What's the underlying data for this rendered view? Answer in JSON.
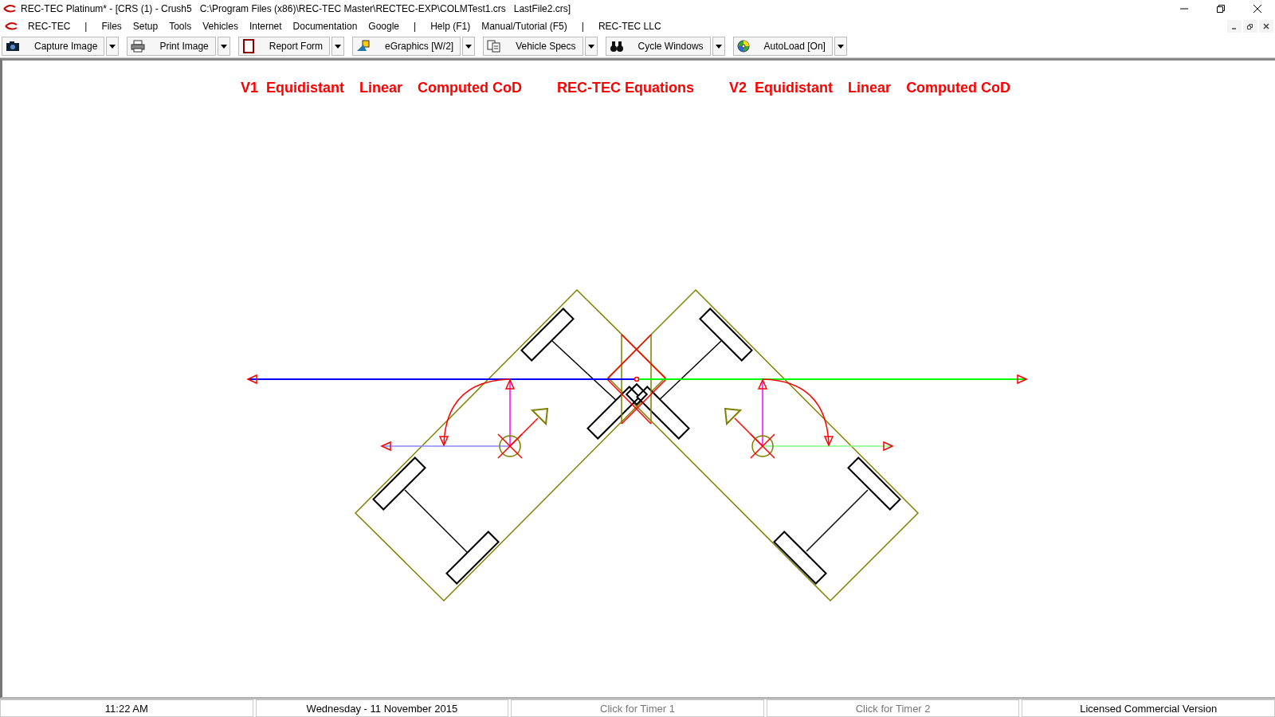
{
  "window": {
    "title": "REC-TEC Platinum* - [CRS (1) - Crush5   C:\\Program Files (x86)\\REC-TEC Master\\RECTEC-EXP\\COLMTest1.crs   LastFile2.crs]"
  },
  "menu": [
    {
      "label": "REC-TEC",
      "kind": "item"
    },
    {
      "label": "|",
      "kind": "separator"
    },
    {
      "label": "Files",
      "kind": "item"
    },
    {
      "label": "Setup",
      "kind": "item"
    },
    {
      "label": "Tools",
      "kind": "item"
    },
    {
      "label": "Vehicles",
      "kind": "item"
    },
    {
      "label": "Internet",
      "kind": "item"
    },
    {
      "label": "Documentation",
      "kind": "item"
    },
    {
      "label": "Google",
      "kind": "item"
    },
    {
      "label": "|",
      "kind": "separator"
    },
    {
      "label": "Help (F1)",
      "kind": "item"
    },
    {
      "label": "Manual/Tutorial (F5)",
      "kind": "item"
    },
    {
      "label": "|",
      "kind": "separator"
    },
    {
      "label": "REC-TEC LLC",
      "kind": "item"
    }
  ],
  "toolbar": [
    {
      "label": "Capture Image"
    },
    {
      "label": "Print Image"
    },
    {
      "label": "Report Form"
    },
    {
      "label": "eGraphics [W/2]"
    },
    {
      "label": "Vehicle Specs"
    },
    {
      "label": "Cycle Windows"
    },
    {
      "label": "AutoLoad [On]"
    }
  ],
  "diagram": {
    "headings": [
      "V1  Equidistant",
      "Linear",
      "Computed CoD",
      "REC-TEC Equations",
      "V2  Equidistant",
      "Linear",
      "Computed CoD"
    ]
  },
  "status_bar": [
    {
      "text": "11:22 AM",
      "dimmed": false
    },
    {
      "text": "Wednesday  -  11 November 2015",
      "dimmed": false
    },
    {
      "text": "Click for Timer 1",
      "dimmed": true
    },
    {
      "text": "Click for Timer 2",
      "dimmed": true
    },
    {
      "text": "Licensed Commercial Version",
      "dimmed": false
    }
  ]
}
